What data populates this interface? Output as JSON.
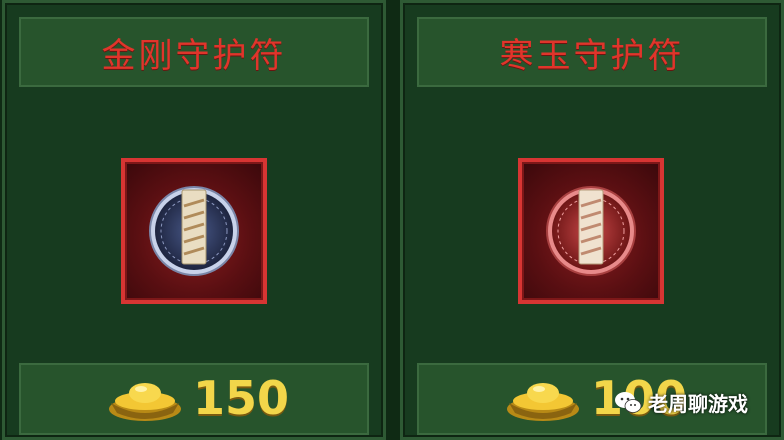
{
  "items": [
    {
      "name": "金刚守护符",
      "price": "150",
      "icon": "vajra-amulet-icon",
      "ring_color": "#a9b5d6"
    },
    {
      "name": "寒玉守护符",
      "price": "100",
      "icon": "jade-amulet-icon",
      "ring_color": "#e07a7a"
    }
  ],
  "currency": {
    "icon": "gold-ingot-icon"
  },
  "watermark": {
    "text": "老周聊游戏",
    "icon": "wechat-icon"
  },
  "colors": {
    "title": "#e0352b",
    "price": "#f2d64a",
    "frame": "#d73533",
    "panel": "#173b1f"
  }
}
